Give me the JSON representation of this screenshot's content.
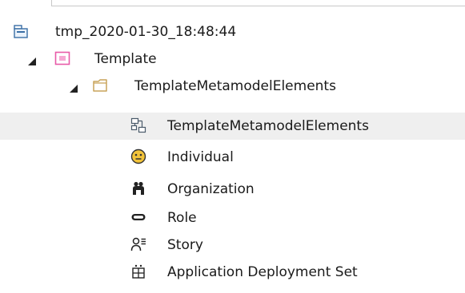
{
  "tree": {
    "root": {
      "label": "tmp_2020-01-30_18:48:44",
      "icon": "package-root-icon"
    },
    "template": {
      "label": "Template",
      "icon": "template-diagram-icon",
      "expanded": true
    },
    "folder": {
      "label": "TemplateMetamodelElements",
      "icon": "folder-icon",
      "expanded": true
    },
    "items": [
      {
        "label": "TemplateMetamodelElements",
        "icon": "diagram-icon",
        "selected": true
      },
      {
        "label": "Individual",
        "icon": "individual-icon"
      },
      {
        "label": "Organization",
        "icon": "organization-icon"
      },
      {
        "label": "Role",
        "icon": "role-icon"
      },
      {
        "label": "Story",
        "icon": "story-icon"
      },
      {
        "label": "Application Deployment Set",
        "icon": "application-deployment-set-icon"
      }
    ],
    "colors": {
      "selection": "#efefef",
      "folder": "#c9a45a",
      "template_pink": "#e85aa8",
      "individual": "#f2c33a"
    }
  }
}
